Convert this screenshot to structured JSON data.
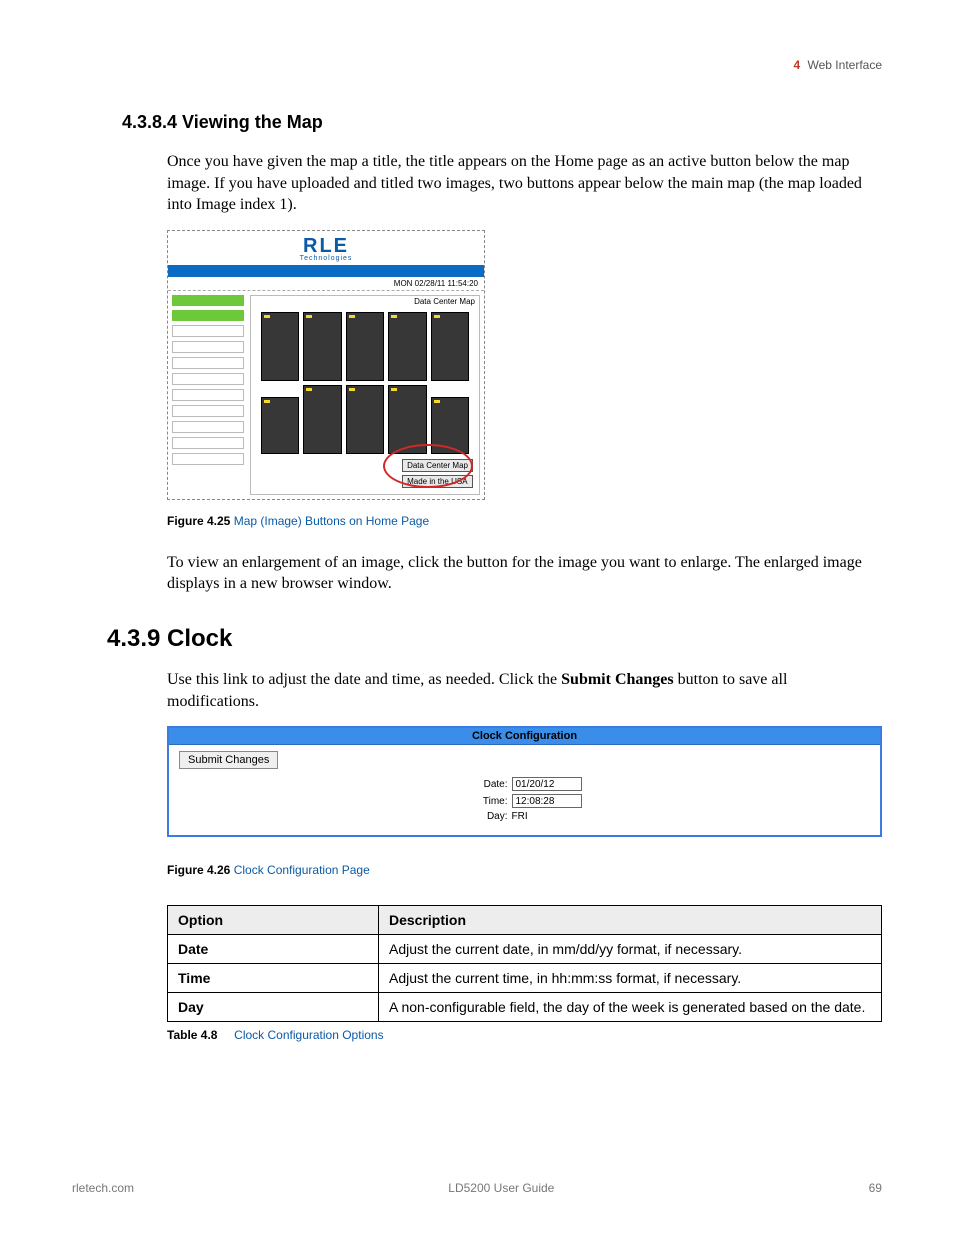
{
  "header": {
    "chapter_number": "4",
    "chapter_title": "Web Interface"
  },
  "sec_4_3_8_4": {
    "heading": "4.3.8.4 Viewing the Map",
    "para1": "Once you have given the map a title, the title appears on the Home page as an active button below the map image. If you have uploaded and titled two images, two buttons appear below the main map (the map loaded into Image index 1).",
    "para2": "To view an enlargement of an image, click the button for the image you want to enlarge. The enlarged image displays in a new browser window."
  },
  "figure_4_25": {
    "logo_text": "RLE",
    "logo_sub": "Technologies",
    "timestamp": "MON 02/28/11 11:54:20",
    "map_title": "Data Center Map",
    "button1": "Data Center Map",
    "button2": "Made in the USA",
    "caption_label": "Figure 4.25",
    "caption_text": "Map (Image) Buttons on Home Page"
  },
  "sec_4_3_9": {
    "number": "4.3.9",
    "title": "Clock",
    "para_pre": "Use this link to adjust the date and time, as needed. Click the ",
    "para_bold": "Submit Changes",
    "para_post": " button to save all modifications."
  },
  "figure_4_26": {
    "panel_title": "Clock Configuration",
    "submit_label": "Submit Changes",
    "date_label": "Date:",
    "date_value": "01/20/12",
    "time_label": "Time:",
    "time_value": "12:08:28",
    "day_label": "Day:",
    "day_value": "FRI",
    "caption_label": "Figure 4.26",
    "caption_text": "Clock Configuration Page"
  },
  "table_4_8": {
    "headers": {
      "c1": "Option",
      "c2": "Description"
    },
    "rows": [
      {
        "opt": "Date",
        "desc": "Adjust the current date, in mm/dd/yy format, if necessary."
      },
      {
        "opt": "Time",
        "desc": "Adjust the current time, in hh:mm:ss format, if necessary."
      },
      {
        "opt": "Day",
        "desc": "A non-configurable field, the day of the week is generated based on the date."
      }
    ],
    "caption_label": "Table 4.8",
    "caption_text": "Clock Configuration Options"
  },
  "footer": {
    "left": "rletech.com",
    "center": "LD5200 User Guide",
    "right": "69"
  }
}
